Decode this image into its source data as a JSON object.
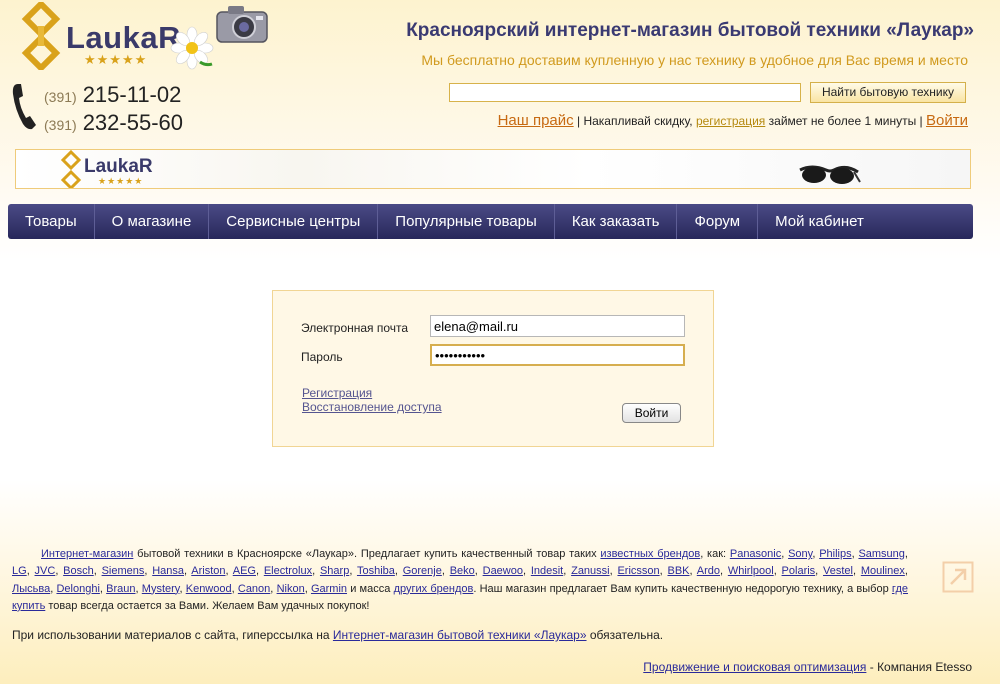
{
  "header": {
    "logo_text": "LaukaR",
    "logo_stars": "★★★★★",
    "title": "Красноярский интернет-магазин бытовой техники «Лаукар»",
    "slogan": "Мы бесплатно доставим купленную у нас технику в удобное для Вас время и место",
    "phones": [
      {
        "code": "(391)",
        "number": "215-11-02"
      },
      {
        "code": "(391)",
        "number": "232-55-60"
      }
    ],
    "search_value": "",
    "search_button": "Найти бытовую технику",
    "links": {
      "price": "Наш прайс",
      "sep1": "|",
      "discount_pre": "Накапливай скидку,",
      "register": "регистрация",
      "discount_post": "займет не более 1 минуты",
      "sep2": "|",
      "login": "Войти"
    }
  },
  "banner": {
    "logo_text": "LaukaR",
    "logo_stars": "★★★★★"
  },
  "nav": [
    "Товары",
    "О магазине",
    "Сервисные центры",
    "Популярные товары",
    "Как заказать",
    "Форум",
    "Мой кабинет"
  ],
  "login_form": {
    "email_label": "Электронная почта",
    "email_value": "elena@mail.ru",
    "password_label": "Пароль",
    "password_value": "•••••••••••",
    "register_link": "Регистрация",
    "restore_link": "Восстановление доступа",
    "submit": "Войти"
  },
  "footer": {
    "seo": {
      "intro_link": "Интернет-магазин",
      "intro_text": "бытовой техники в Красноярске «Лаукар». Предлагает купить качественный товар таких",
      "brands_link": "известных брендов",
      "as": ", как:",
      "brands": [
        "Panasonic",
        "Sony",
        "Philips",
        "Samsung",
        "LG",
        "JVC",
        "Bosch",
        "Siemens",
        "Hansa",
        "Ariston",
        "AEG",
        "Electrolux",
        "Sharp",
        "Toshiba",
        "Gorenje",
        "Beko",
        "Daewoo",
        "Indesit",
        "Zanussi",
        "Ericsson",
        "BBK",
        "Ardo",
        "Whirlpool",
        "Polaris",
        "Vestel",
        "Moulinex",
        "Лысьва",
        "Delonghi",
        "Braun",
        "Mystery",
        "Kenwood",
        "Canon",
        "Nikon",
        "Garmin"
      ],
      "and_mass": "и масса",
      "other_brands_link": "других брендов",
      "after_text": ". Наш магазин предлагает Вам купить качественную недорогую технику, а выбор",
      "where_link": "где купить",
      "closing": "товар всегда остается за Вами. Желаем Вам удачных покупок!"
    },
    "notice_text": "При использовании материалов с сайта, гиперссылка на",
    "notice_link": "Интернет-магазин бытовой техники «Лаукар»",
    "notice_end": "обязательна.",
    "seo_link": "Продвижение и поисковая оптимизация",
    "company": "- Компания Etesso"
  },
  "colors": {
    "nav_bg": "#2f2f66",
    "title": "#3a3a72",
    "slogan": "#d19a1e",
    "link": "#2a2a9a",
    "accent_link": "#c76a12"
  }
}
